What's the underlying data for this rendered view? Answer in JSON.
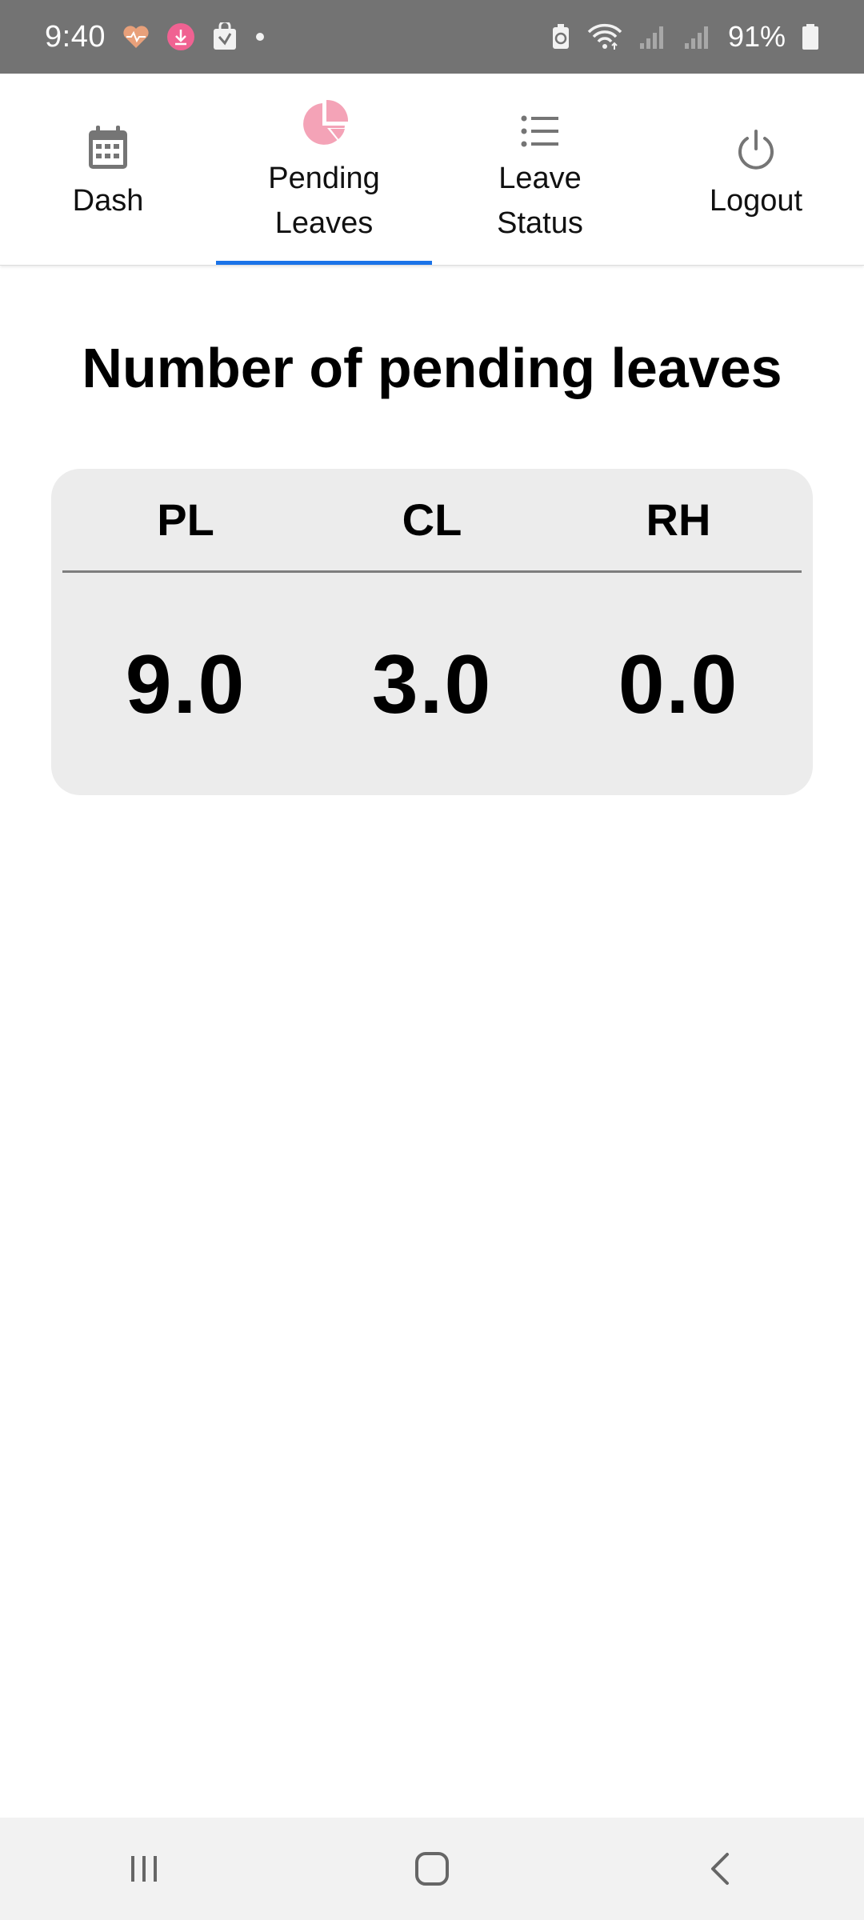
{
  "status_bar": {
    "time": "9:40",
    "battery": "91%"
  },
  "tabs": [
    {
      "label_line1": "Dash",
      "label_line2": "",
      "icon": "calendar-icon",
      "active": false
    },
    {
      "label_line1": "Pending",
      "label_line2": "Leaves",
      "icon": "pie-chart-icon",
      "active": true
    },
    {
      "label_line1": "Leave",
      "label_line2": "Status",
      "icon": "list-icon",
      "active": false
    },
    {
      "label_line1": "Logout",
      "label_line2": "",
      "icon": "power-icon",
      "active": false
    }
  ],
  "main": {
    "title": "Number of pending leaves",
    "leave_table": {
      "headers": [
        "PL",
        "CL",
        "RH"
      ],
      "values": [
        "9.0",
        "3.0",
        "0.0"
      ]
    }
  },
  "colors": {
    "accent": "#1a73e8",
    "active_icon": "#f4a3b7",
    "icon_gray": "#757575"
  }
}
